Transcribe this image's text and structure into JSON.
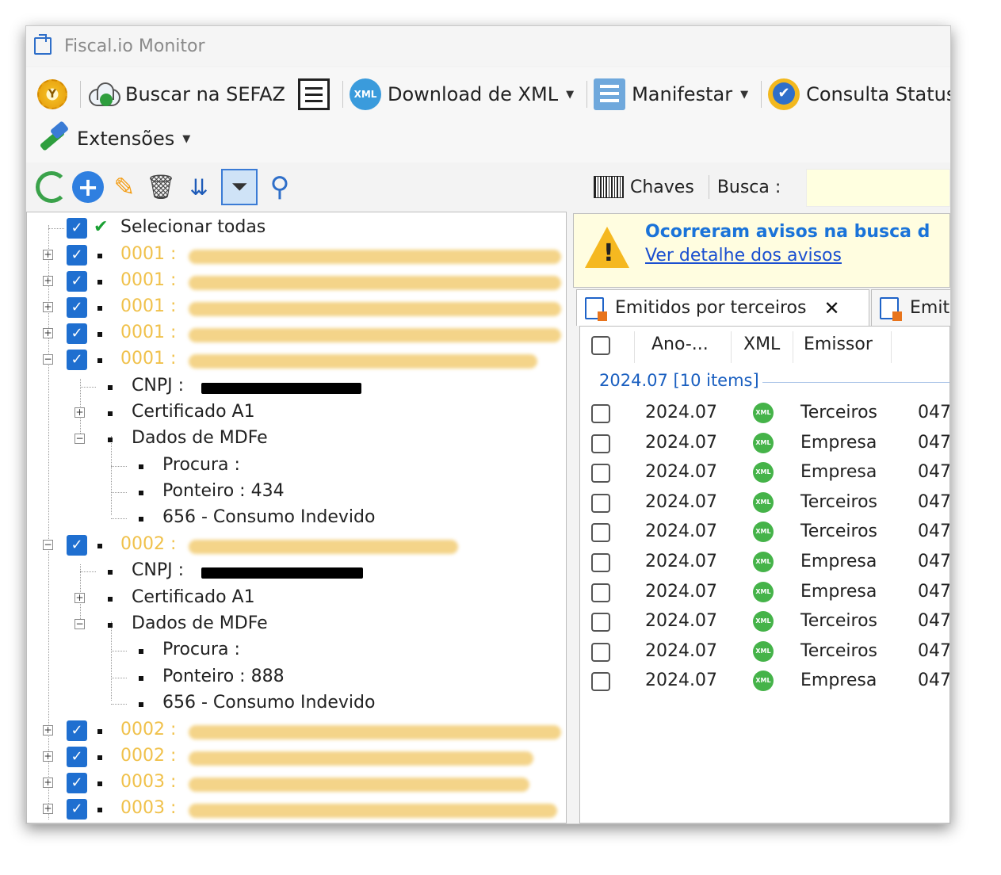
{
  "window": {
    "title": "Fiscal.io Monitor"
  },
  "toolbar": {
    "buscar_label": "Buscar na SEFAZ",
    "download_label": "Download de XML",
    "manifestar_label": "Manifestar",
    "consulta_label": "Consulta Status",
    "extensoes_label": "Extensões",
    "xml_badge": "XML"
  },
  "tree": {
    "select_all": "Selecionar todas",
    "rows": [
      {
        "code": "0001 :"
      },
      {
        "code": "0001 :"
      },
      {
        "code": "0001 :"
      },
      {
        "code": "0001 :"
      },
      {
        "code": "0001 :"
      }
    ],
    "company_a": {
      "cnpj_label": "CNPJ :",
      "cert_label": "Certificado A1",
      "dados_label": "Dados de MDFe",
      "procura_label": "Procura :",
      "ponteiro_label": "Ponteiro : 434",
      "status_label": "656 - Consumo Indevido"
    },
    "company_b_code": "0002 :",
    "company_b": {
      "cnpj_label": "CNPJ :",
      "cert_label": "Certificado A1",
      "dados_label": "Dados de MDFe",
      "procura_label": "Procura :",
      "ponteiro_label": "Ponteiro : 888",
      "status_label": "656 - Consumo Indevido"
    },
    "tail_rows": [
      {
        "code": "0002 :"
      },
      {
        "code": "0002 :"
      },
      {
        "code": "0003 :"
      },
      {
        "code": "0003 :"
      }
    ]
  },
  "right": {
    "chaves_label": "Chaves",
    "busca_label": "Busca :",
    "warning_title": "Ocorreram avisos na busca d",
    "warning_link": "Ver detalhe dos avisos",
    "tab1_label": "Emitidos por terceiros",
    "tab2_label": "Emit",
    "columns": {
      "ano": "Ano-...",
      "xml": "XML",
      "emissor": "Emissor"
    },
    "group_label": "2024.07 [10 items]",
    "rows": [
      {
        "ano": "2024.07",
        "emissor": "Terceiros",
        "num": "047"
      },
      {
        "ano": "2024.07",
        "emissor": "Empresa",
        "num": "047"
      },
      {
        "ano": "2024.07",
        "emissor": "Empresa",
        "num": "047"
      },
      {
        "ano": "2024.07",
        "emissor": "Terceiros",
        "num": "047"
      },
      {
        "ano": "2024.07",
        "emissor": "Terceiros",
        "num": "047"
      },
      {
        "ano": "2024.07",
        "emissor": "Empresa",
        "num": "047"
      },
      {
        "ano": "2024.07",
        "emissor": "Empresa",
        "num": "047"
      },
      {
        "ano": "2024.07",
        "emissor": "Terceiros",
        "num": "047"
      },
      {
        "ano": "2024.07",
        "emissor": "Terceiros",
        "num": "047"
      },
      {
        "ano": "2024.07",
        "emissor": "Empresa",
        "num": "047"
      }
    ],
    "xml_badge": "XML"
  }
}
